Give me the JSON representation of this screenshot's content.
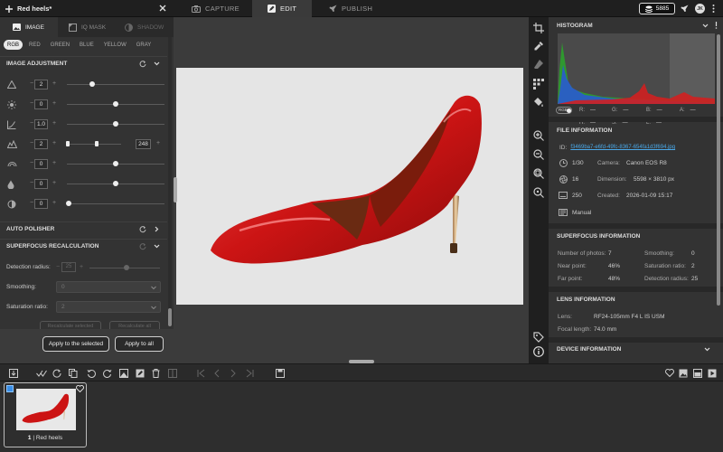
{
  "top_bar": {
    "doc_title": "Red heels*",
    "modes": [
      {
        "label": "CAPTURE",
        "icon": "camera-icon",
        "active": false
      },
      {
        "label": "EDIT",
        "icon": "edit-icon",
        "active": true
      },
      {
        "label": "PUBLISH",
        "icon": "rocket-icon",
        "active": false
      }
    ],
    "credits": "5885",
    "avatar": "JK"
  },
  "left_panel": {
    "tabs": [
      {
        "label": "IMAGE",
        "icon": "image-icon",
        "active": true
      },
      {
        "label": "IQ MASK",
        "icon": "mask-icon",
        "active": false
      },
      {
        "label": "SHADOW",
        "icon": "shadow-icon",
        "active": false
      }
    ],
    "channels": [
      "RGB",
      "RED",
      "GREEN",
      "BLUE",
      "YELLOW",
      "GRAY"
    ],
    "active_channel": "RGB",
    "image_adjustment": {
      "title": "IMAGE ADJUSTMENT",
      "rows": [
        {
          "name": "exposure",
          "icon": "exposure-icon",
          "value": "2",
          "level": 0.26
        },
        {
          "name": "brightness",
          "icon": "brightness-icon",
          "value": "0",
          "level": 0.5
        },
        {
          "name": "contrast",
          "icon": "contrast-icon",
          "value": "1.0",
          "level": 0.5
        },
        {
          "name": "levels",
          "icon": "levels-icon",
          "value": "2",
          "value_high": "248",
          "level_low": 0.01,
          "level_high": 0.55
        },
        {
          "name": "saturation",
          "icon": "saturation-icon",
          "value": "0",
          "level": 0.5
        },
        {
          "name": "vibrance",
          "icon": "vibrance-icon",
          "value": "0",
          "level": 0.5
        },
        {
          "name": "sharpness",
          "icon": "sharpness-icon",
          "value": "0",
          "level": 0.02
        }
      ]
    },
    "auto_polisher": {
      "title": "AUTO POLISHER"
    },
    "superfocus": {
      "title": "SUPERFOCUS RECALCULATION",
      "detection_radius_label": "Detection radius:",
      "detection_radius_value": "25",
      "smoothing_label": "Smoothing:",
      "smoothing_value": "0",
      "saturation_label": "Saturation ratio:",
      "saturation_value": "2",
      "recalc_selected": "Recalculate selected",
      "recalc_all": "Recalculate all"
    },
    "apply_selected": "Apply to the selected",
    "apply_all": "Apply to all"
  },
  "right_panel": {
    "histogram": {
      "title": "HISTOGRAM",
      "toggle_label": "RGB",
      "values": [
        {
          "k": "R:",
          "v": "—"
        },
        {
          "k": "G:",
          "v": "—"
        },
        {
          "k": "B:",
          "v": "—"
        },
        {
          "k": "A:",
          "v": "—"
        },
        {
          "k": "H:",
          "v": "—"
        },
        {
          "k": "S:",
          "v": "—"
        },
        {
          "k": "L:",
          "v": "—"
        }
      ]
    },
    "file_info": {
      "title": "FILE INFORMATION",
      "id_label": "ID:",
      "id_value": "f3469ba7-e6fd-49fc-8367-654fa1d3f694.jpg",
      "shutter": "1/30",
      "camera_label": "Camera:",
      "camera_value": "Canon EOS R8",
      "aperture": "16",
      "dimension_label": "Dimension:",
      "dimension_value": "5598 × 3810 px",
      "iso": "250",
      "created_label": "Created:",
      "created_value": "2026-01-09 15:17",
      "mode": "Manual"
    },
    "superfocus_info": {
      "title": "SUPERFOCUS INFORMATION",
      "items": [
        {
          "k": "Number of photos:",
          "v": "7"
        },
        {
          "k": "Smoothing:",
          "v": "0"
        },
        {
          "k": "Near point:",
          "v": "46%"
        },
        {
          "k": "Saturation ratio:",
          "v": "2"
        },
        {
          "k": "Far point:",
          "v": "48%"
        },
        {
          "k": "Detection radius:",
          "v": "25"
        }
      ]
    },
    "lens_info": {
      "title": "LENS INFORMATION",
      "lens_label": "Lens:",
      "lens_value": "RF24-105mm F4 L IS USM",
      "focal_label": "Focal length:",
      "focal_value": "74.0 mm"
    },
    "device_info": {
      "title": "DEVICE INFORMATION"
    }
  },
  "filmstrip": {
    "items": [
      {
        "index": "1",
        "name": "Red heels"
      }
    ]
  },
  "colors": {
    "accent": "#3a8ee6",
    "shoe_red": "#d01818",
    "link": "#4aa8e8"
  }
}
